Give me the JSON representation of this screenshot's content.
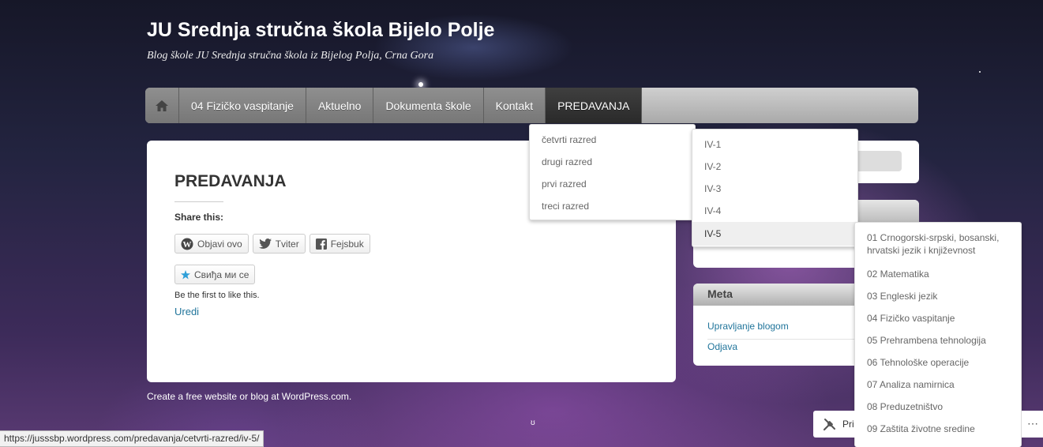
{
  "site": {
    "title": "JU Srednja stručna škola Bijelo Polje",
    "description": "Blog škole JU Srednja stručna škola iz Bijelog Polja, Crna Gora"
  },
  "nav": {
    "home_icon": "home-icon",
    "items": [
      "04 Fizičko vaspitanje",
      "Aktuelno",
      "Dokumenta škole",
      "Kontakt",
      "PREDAVANJA"
    ],
    "active": "PREDAVANJA"
  },
  "dropdowns": {
    "level1": [
      "četvrti razred",
      "drugi razred",
      "prvi razred",
      "treci razred"
    ],
    "level2": [
      "IV-1",
      "IV-2",
      "IV-3",
      "IV-4",
      "IV-5"
    ],
    "level2_highlighted": "IV-5",
    "level3": [
      "01 Crnogorski-srpski, bosanski, hrvatski jezik i književnost",
      "02 Matematika",
      "03 Engleski jezik",
      "04 Fizičko vaspitanje",
      "05 Prehrambena tehnologija",
      "06 Tehnološke operacije",
      "07 Analiza namirnica",
      "08 Preduzetništvo",
      "09 Zaštita životne sredine"
    ]
  },
  "main": {
    "title": "PREDAVANJA",
    "share_label": "Share this:",
    "share_buttons": [
      {
        "label": "Objavi ovo",
        "icon": "wordpress-icon"
      },
      {
        "label": "Tviter",
        "icon": "twitter-icon"
      },
      {
        "label": "Fejsbuk",
        "icon": "facebook-icon"
      }
    ],
    "like_button": "Свиђа ми се",
    "like_icon": "star-icon",
    "first_like": "Be the first to like this.",
    "edit_link": "Uredi"
  },
  "sidebar": {
    "meta_title": "Meta",
    "meta_links": [
      "Upravljanje blogom",
      "Odjava"
    ]
  },
  "footer": {
    "credit": "Create a free website or blog at WordPress.com.",
    "status_url": "https://jusssbp.wordpress.com/predavanja/cetvrti-razred/iv-5/",
    "bottom_widget_text": "Pri",
    "bottom_widget_icon": "tools-icon",
    "more_icon": "ellipsis-icon"
  },
  "colors": {
    "link": "#21759b",
    "nav_bg": "#777777",
    "nav_active": "#2a2a2a"
  }
}
